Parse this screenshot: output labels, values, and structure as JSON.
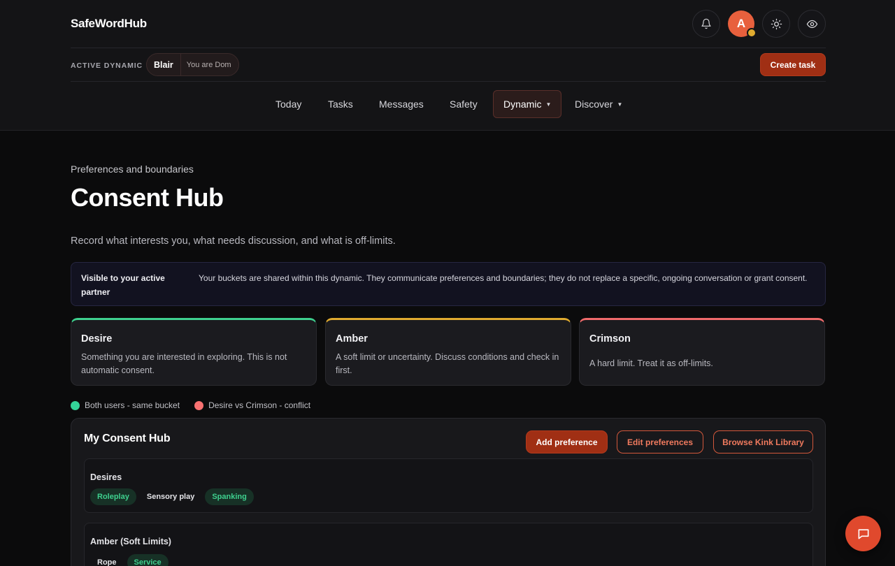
{
  "brand": "SafeWordHub",
  "header": {
    "avatar_initial": "A",
    "icons": [
      "bell-icon",
      "sun-icon",
      "eye-icon"
    ]
  },
  "dynamic_bar": {
    "label": "ACTIVE DYNAMIC",
    "partner_name": "Blair",
    "partner_role": "You are Dom",
    "create_task_label": "Create task"
  },
  "nav": {
    "items": [
      {
        "label": "Today"
      },
      {
        "label": "Tasks"
      },
      {
        "label": "Messages"
      },
      {
        "label": "Safety"
      },
      {
        "label": "Dynamic",
        "active": true
      },
      {
        "label": "Discover"
      }
    ]
  },
  "page": {
    "eyebrow": "Preferences and boundaries",
    "title": "Consent Hub",
    "subtitle": "Record what interests you, what needs discussion, and what is off-limits."
  },
  "notice": {
    "label": "Visible to your active partner",
    "text": "Your buckets are shared within this dynamic. They communicate preferences and boundaries; they do not replace a specific, ongoing conversation or grant consent."
  },
  "buckets": [
    {
      "name": "Desire",
      "description": "Something you are interested in exploring. This is not automatic consent.",
      "color": "#3ed08e"
    },
    {
      "name": "Amber",
      "description": "A soft limit or uncertainty. Discuss conditions and check in first.",
      "color": "#e0ab2f"
    },
    {
      "name": "Crimson",
      "description": "A hard limit. Treat it as off-limits.",
      "color": "#f06b6b"
    }
  ],
  "legend": [
    {
      "label": "Both users - same bucket",
      "color": "#34d399"
    },
    {
      "label": "Desire vs Crimson - conflict",
      "color": "#f87171"
    }
  ],
  "hub": {
    "title": "My Consent Hub",
    "add_label": "Add preference",
    "edit_label": "Edit preferences",
    "browse_label": "Browse Kink Library",
    "groups": [
      {
        "title": "Desires",
        "tags": [
          {
            "label": "Roleplay",
            "match": true
          },
          {
            "label": "Sensory play",
            "match": false
          },
          {
            "label": "Spanking",
            "match": true
          }
        ]
      },
      {
        "title": "Amber (Soft Limits)",
        "tags": [
          {
            "label": "Rope",
            "match": false
          },
          {
            "label": "Service",
            "match": true
          }
        ]
      }
    ]
  }
}
